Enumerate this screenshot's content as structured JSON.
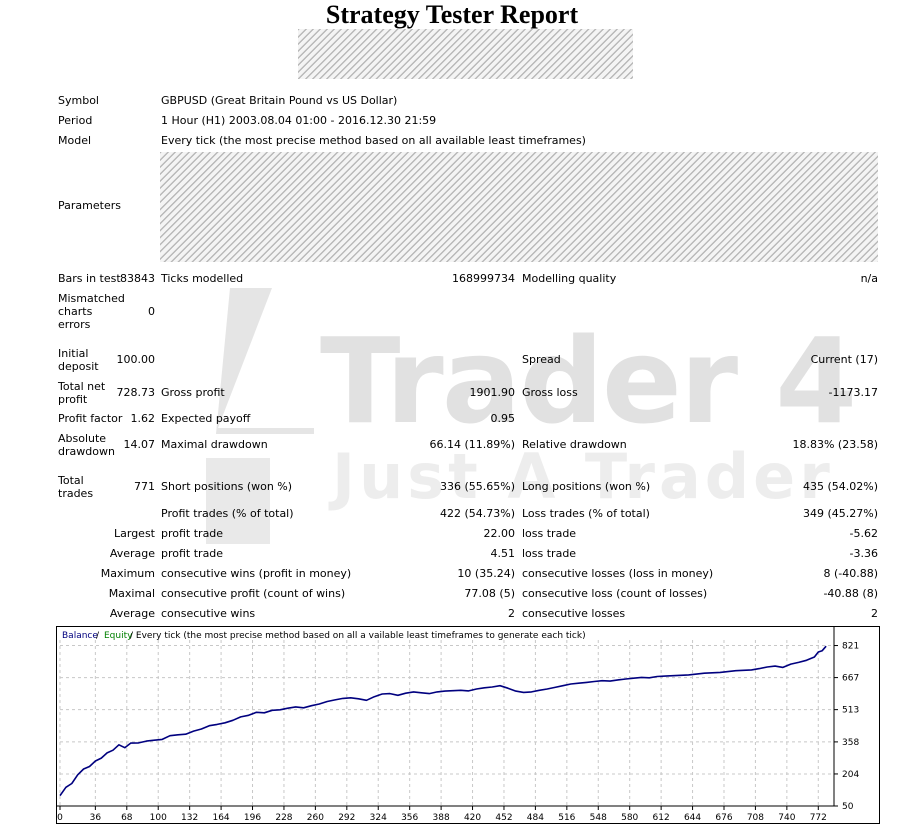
{
  "report": {
    "title": "Strategy Tester Report",
    "watermark_line1": "Trader 4",
    "watermark_line2": "Just A Trader"
  },
  "info": {
    "symbol_label": "Symbol",
    "symbol_value": "GBPUSD (Great Britain Pound vs US Dollar)",
    "period_label": "Period",
    "period_value": "1 Hour (H1) 2003.08.04 01:00 - 2016.12.30 21:59",
    "model_label": "Model",
    "model_value": "Every tick (the most precise method based on all available least timeframes)",
    "parameters_label": "Parameters"
  },
  "stats": {
    "bars_label": "Bars in test",
    "bars_value": "83843",
    "ticks_label": "Ticks modelled",
    "ticks_value": "168999734",
    "quality_label": "Modelling quality",
    "quality_value": "n/a",
    "mismatch_label": [
      "Mismatched",
      "charts",
      "errors"
    ],
    "mismatch_value": "0",
    "deposit_label": [
      "Initial",
      "deposit"
    ],
    "deposit_value": "100.00",
    "spread_label": "Spread",
    "spread_value": "Current (17)",
    "net_label": [
      "Total net",
      "profit"
    ],
    "net_value": "728.73",
    "gross_profit_label": "Gross profit",
    "gross_profit_value": "1901.90",
    "gross_loss_label": "Gross loss",
    "gross_loss_value": "-1173.17",
    "pf_label": "Profit factor",
    "pf_value": "1.62",
    "payoff_label": "Expected payoff",
    "payoff_value": "0.95",
    "abs_dd_label": [
      "Absolute",
      "drawdown"
    ],
    "abs_dd_value": "14.07",
    "max_dd_label": "Maximal drawdown",
    "max_dd_value": "66.14 (11.89%)",
    "rel_dd_label": "Relative drawdown",
    "rel_dd_value": "18.83% (23.58)",
    "total_trades_label": [
      "Total",
      "trades"
    ],
    "total_trades_value": "771",
    "short_label": "Short positions (won %)",
    "short_value": "336 (55.65%)",
    "long_label": "Long positions (won %)",
    "long_value": "435 (54.02%)",
    "profit_trades_label": "Profit trades (% of total)",
    "profit_trades_value": "422 (54.73%)",
    "loss_trades_label": "Loss trades (% of total)",
    "loss_trades_value": "349 (45.27%)",
    "largest_label": "Largest",
    "largest_profit_label": "profit trade",
    "largest_profit_value": "22.00",
    "largest_loss_label": "loss trade",
    "largest_loss_value": "-5.62",
    "average_label": "Average",
    "average_profit_label": "profit trade",
    "average_profit_value": "4.51",
    "average_loss_label": "loss trade",
    "average_loss_value": "-3.36",
    "maximum_label": "Maximum",
    "max_cons_wins_label": "consecutive wins (profit in money)",
    "max_cons_wins_value": "10 (35.24)",
    "max_cons_losses_label": "consecutive losses (loss in money)",
    "max_cons_losses_value": "8 (-40.88)",
    "maximal_label": "Maximal",
    "maximal_profit_label": "consecutive profit (count of wins)",
    "maximal_profit_value": "77.08 (5)",
    "maximal_loss_label": "consecutive loss (count of losses)",
    "maximal_loss_value": "-40.88 (8)",
    "average2_label": "Average",
    "avg_cons_wins_label": "consecutive wins",
    "avg_cons_wins_value": "2",
    "avg_cons_losses_label": "consecutive losses",
    "avg_cons_losses_value": "2"
  },
  "chart_data": {
    "type": "line",
    "legend": {
      "balance": "Balance",
      "sep1": " / ",
      "equity": "Equity",
      "rest": " / Every tick (the most precise method based on all a vailable least timeframes to generate each tick)"
    },
    "colors": {
      "balance": "#00007f",
      "equity": "#008000",
      "grid": "#c8c8c8"
    },
    "x_ticks": [
      0,
      36,
      68,
      100,
      132,
      164,
      196,
      228,
      260,
      292,
      324,
      356,
      388,
      420,
      452,
      484,
      516,
      548,
      580,
      612,
      644,
      676,
      708,
      740,
      772
    ],
    "y_ticks": [
      50,
      204,
      358,
      513,
      667,
      821
    ],
    "xlim": [
      0,
      788
    ],
    "ylim": [
      50,
      838
    ],
    "series": [
      {
        "key": "balance",
        "x": [
          0,
          6,
          12,
          18,
          24,
          30,
          36,
          42,
          48,
          54,
          60,
          66,
          72,
          80,
          88,
          96,
          104,
          112,
          120,
          128,
          136,
          144,
          152,
          160,
          168,
          176,
          184,
          192,
          200,
          208,
          216,
          224,
          232,
          240,
          248,
          256,
          264,
          272,
          280,
          288,
          296,
          304,
          312,
          320,
          328,
          336,
          344,
          352,
          360,
          368,
          376,
          384,
          392,
          400,
          408,
          416,
          424,
          432,
          440,
          448,
          456,
          464,
          472,
          480,
          488,
          496,
          504,
          512,
          520,
          528,
          536,
          544,
          552,
          560,
          568,
          576,
          584,
          592,
          600,
          608,
          616,
          624,
          632,
          640,
          648,
          656,
          664,
          672,
          680,
          688,
          696,
          704,
          712,
          720,
          728,
          736,
          744,
          752,
          760,
          768,
          772,
          776,
          780
        ],
        "y": [
          100,
          140,
          158,
          200,
          228,
          240,
          266,
          280,
          305,
          318,
          344,
          330,
          352,
          353,
          362,
          366,
          370,
          388,
          392,
          395,
          410,
          420,
          436,
          442,
          450,
          462,
          478,
          486,
          500,
          498,
          510,
          512,
          520,
          526,
          522,
          532,
          540,
          552,
          560,
          567,
          570,
          565,
          558,
          575,
          588,
          590,
          582,
          592,
          598,
          594,
          590,
          598,
          602,
          604,
          606,
          603,
          612,
          618,
          622,
          628,
          616,
          602,
          596,
          598,
          606,
          612,
          620,
          628,
          636,
          640,
          644,
          648,
          652,
          650,
          656,
          660,
          664,
          668,
          666,
          672,
          674,
          676,
          678,
          680,
          684,
          688,
          690,
          692,
          696,
          700,
          702,
          704,
          710,
          718,
          722,
          716,
          732,
          740,
          750,
          766,
          790,
          796,
          818
        ]
      }
    ]
  }
}
